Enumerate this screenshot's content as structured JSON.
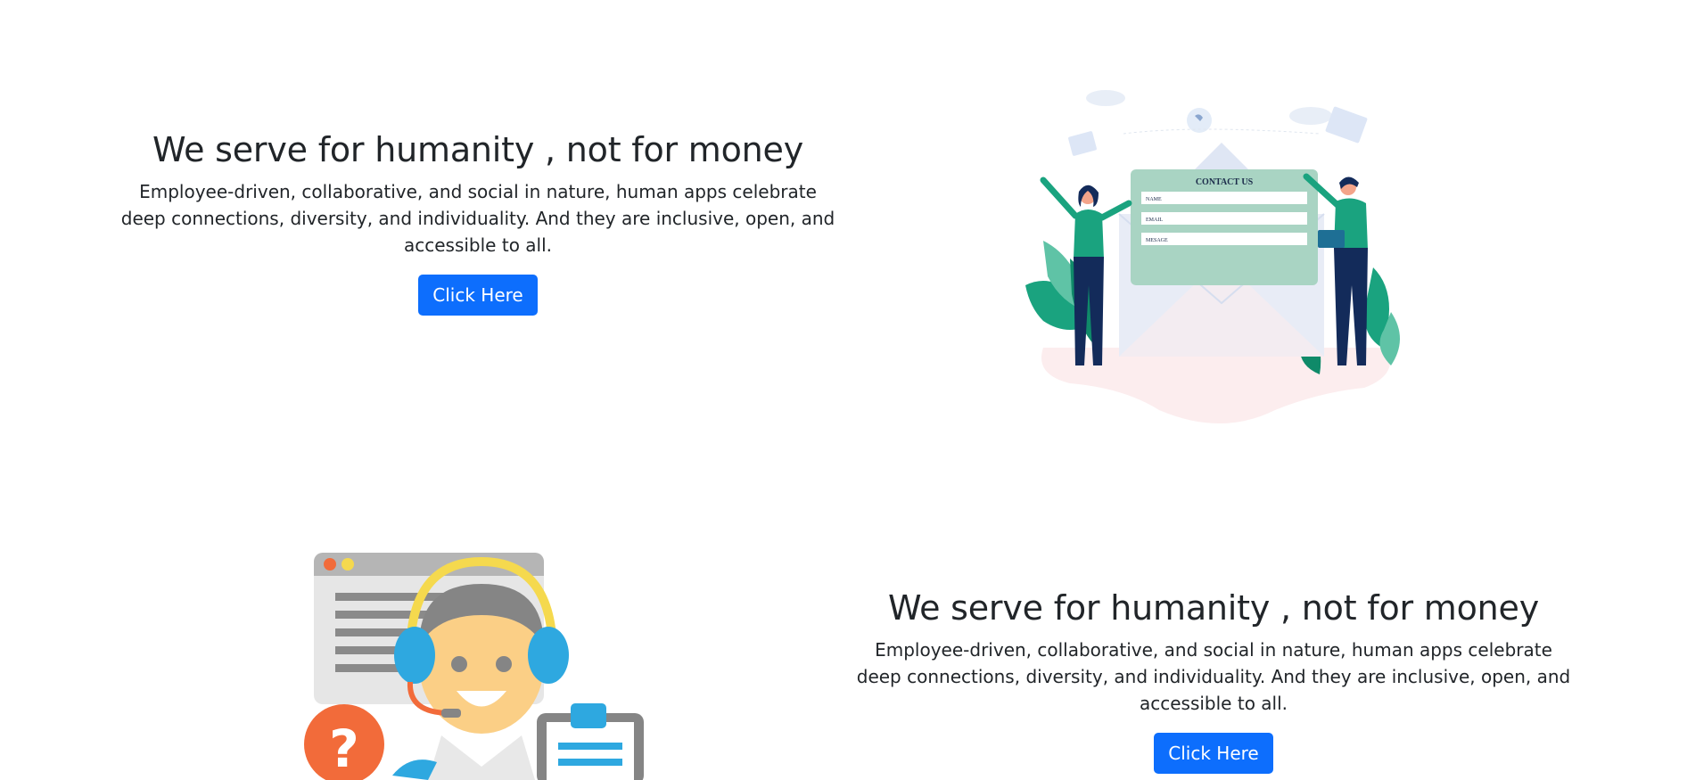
{
  "section1": {
    "title": "We serve for humanity , not for money",
    "description": "Employee-driven, collaborative, and social in nature, human apps celebrate deep connections, diversity, and individuality. And they are inclusive, open, and accessible to all.",
    "button_label": "Click Here"
  },
  "section2": {
    "title": "We serve for humanity , not for money",
    "description": "Employee-driven, collaborative, and social in nature, human apps celebrate deep connections, diversity, and individuality. And they are inclusive, open, and accessible to all.",
    "button_label": "Click Here"
  },
  "contact_form": {
    "heading": "CONTACT US",
    "field_name": "NAME",
    "field_email": "EMAIL",
    "field_message": "MESAGE"
  },
  "colors": {
    "button": "#0d6efd",
    "teal": "#1aa37f",
    "navy": "#132b5a",
    "orange": "#f26b3a",
    "support_blue": "#2ea8e0",
    "headset_yellow": "#f5d94e"
  },
  "icons": [
    "contact-us-illustration",
    "customer-support-illustration",
    "question-icon",
    "clipboard-icon"
  ]
}
